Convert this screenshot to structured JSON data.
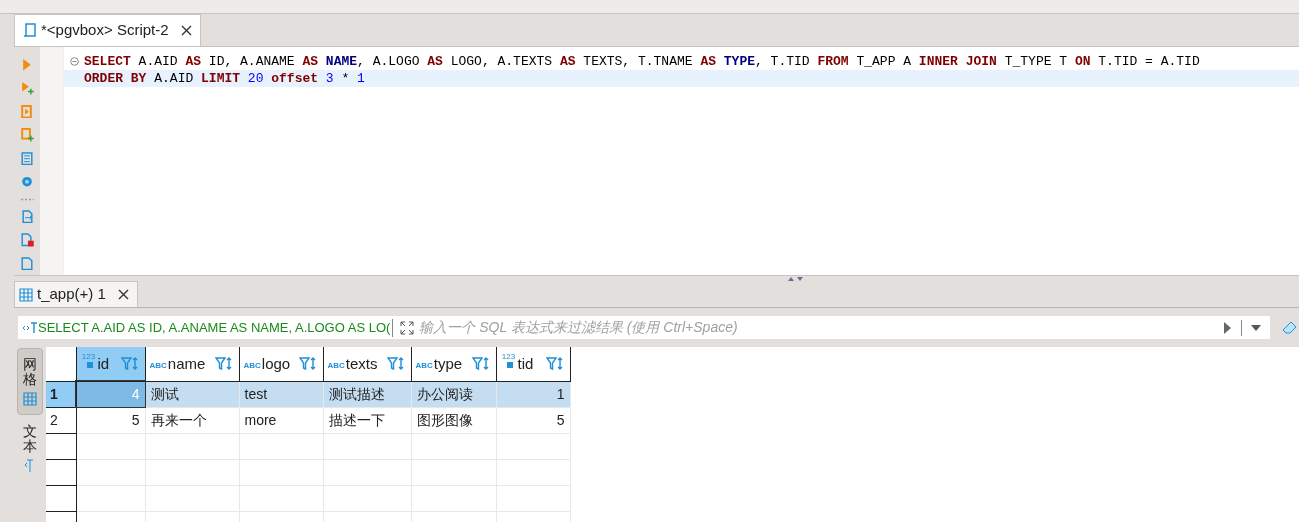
{
  "editor_tab": {
    "label": "*<pgvbox> Script-2",
    "selected": true
  },
  "sql_lines": [
    [
      {
        "text": "SELECT",
        "kind": "keyword"
      },
      {
        "text": " A.AID ",
        "kind": "plain"
      },
      {
        "text": "AS",
        "kind": "keyword"
      },
      {
        "text": " ID, A.ANAME ",
        "kind": "plain"
      },
      {
        "text": "AS",
        "kind": "keyword"
      },
      {
        "text": " NAME",
        "kind": "type"
      },
      {
        "text": ", A.LOGO ",
        "kind": "plain"
      },
      {
        "text": "AS",
        "kind": "keyword"
      },
      {
        "text": " LOGO, A.TEXTS ",
        "kind": "plain"
      },
      {
        "text": "AS",
        "kind": "keyword"
      },
      {
        "text": " TEXTS, T.TNAME ",
        "kind": "plain"
      },
      {
        "text": "AS",
        "kind": "keyword"
      },
      {
        "text": " TYPE",
        "kind": "type"
      },
      {
        "text": ", T.TID ",
        "kind": "plain"
      },
      {
        "text": "FROM",
        "kind": "keyword"
      },
      {
        "text": " T_APP A ",
        "kind": "plain"
      },
      {
        "text": "INNER JOIN",
        "kind": "keyword"
      },
      {
        "text": " T_TYPE T ",
        "kind": "plain"
      },
      {
        "text": "ON",
        "kind": "keyword"
      },
      {
        "text": " T.TID = A.TID",
        "kind": "plain"
      }
    ],
    [
      {
        "text": "ORDER BY",
        "kind": "keyword"
      },
      {
        "text": " A.AID ",
        "kind": "plain"
      },
      {
        "text": "LIMIT",
        "kind": "keyword"
      },
      {
        "text": " 20",
        "kind": "number"
      },
      {
        "text": " offset",
        "kind": "keyword"
      },
      {
        "text": " 3",
        "kind": "number"
      },
      {
        "text": " * ",
        "kind": "plain"
      },
      {
        "text": "1",
        "kind": "number"
      }
    ]
  ],
  "results_tab": {
    "label": "t_app(+) 1",
    "selected": true
  },
  "filter": {
    "query": "SELECT A.AID AS ID, A.ANAME AS NAME, A.LOGO AS LO(",
    "placeholder": "输入一个 SQL 表达式来过滤结果 (使用 Ctrl+Space)"
  },
  "view_tabs": [
    {
      "label": "网格",
      "selected": true
    },
    {
      "label": "文本",
      "selected": false
    }
  ],
  "table": {
    "columns": [
      {
        "label": "id",
        "kind": "number",
        "type_label": "123",
        "selected": true
      },
      {
        "label": "name",
        "kind": "string",
        "type_label": "ABC",
        "selected": false
      },
      {
        "label": "logo",
        "kind": "string",
        "type_label": "ABC",
        "selected": false
      },
      {
        "label": "texts",
        "kind": "string",
        "type_label": "ABC",
        "selected": false
      },
      {
        "label": "type",
        "kind": "string",
        "type_label": "ABC",
        "selected": false
      },
      {
        "label": "tid",
        "kind": "number",
        "type_label": "123",
        "selected": false
      }
    ],
    "rows": [
      {
        "number": "1",
        "selected": true,
        "cells": [
          "4",
          "测试",
          "test",
          "测试描述",
          "办公阅读",
          "1"
        ]
      },
      {
        "number": "2",
        "selected": false,
        "cells": [
          "5",
          "再来一个",
          "more",
          "描述一下",
          "图形图像",
          "5"
        ]
      }
    ]
  }
}
